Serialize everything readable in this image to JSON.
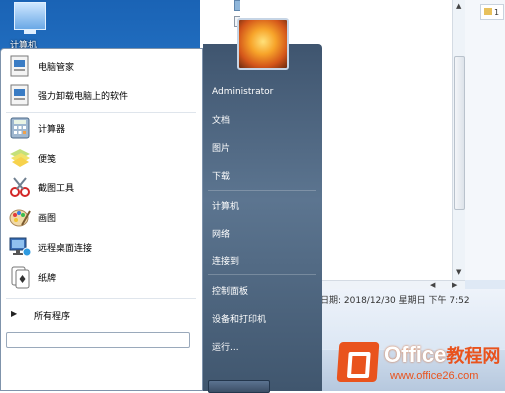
{
  "desktop": {
    "icon_label": "计算机"
  },
  "explorer": {
    "nav_items": [
      {
        "label": "图片",
        "icon": "pictures-icon"
      },
      {
        "label": "文档",
        "icon": "documents-icon"
      }
    ],
    "details_text": "日期: 2018/12/30 星期日 下午 7:52",
    "folder_chip": "1"
  },
  "start_menu": {
    "programs": [
      {
        "label": "电脑管家",
        "icon": "pc-manager-icon"
      },
      {
        "label": "强力卸载电脑上的软件",
        "icon": "uninstaller-icon"
      },
      {
        "label": "计算器",
        "icon": "calculator-icon"
      },
      {
        "label": "便笺",
        "icon": "sticky-notes-icon"
      },
      {
        "label": "截图工具",
        "icon": "snipping-tool-icon"
      },
      {
        "label": "画图",
        "icon": "paint-icon"
      },
      {
        "label": "远程桌面连接",
        "icon": "remote-desktop-icon"
      },
      {
        "label": "纸牌",
        "icon": "solitaire-icon"
      }
    ],
    "all_programs": "所有程序",
    "right_items": [
      "Administrator",
      "文档",
      "图片",
      "下载",
      "计算机",
      "网络",
      "连接到",
      "控制面板",
      "设备和打印机",
      "运行..."
    ]
  },
  "watermark": {
    "brand": "Office",
    "brand_cn": "教程网",
    "url": "www.office26.com"
  },
  "colors": {
    "right_pane": "#4c637d",
    "watermark_orange": "#e9531d",
    "desktop_blue": "#1f6fc4"
  }
}
